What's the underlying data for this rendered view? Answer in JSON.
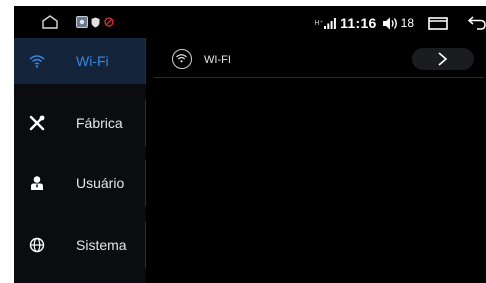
{
  "status": {
    "time": "11:16",
    "volume": "18",
    "signal_tag": "H⁺"
  },
  "sidebar": {
    "items": [
      {
        "label": "Wi-Fi",
        "icon": "wifi-icon",
        "active": true
      },
      {
        "label": "Fábrica",
        "icon": "tools-icon",
        "active": false
      },
      {
        "label": "Usuário",
        "icon": "user-icon",
        "active": false
      },
      {
        "label": "Sistema",
        "icon": "globe-icon",
        "active": false
      }
    ]
  },
  "content": {
    "wifi_row": {
      "label": "WI-FI",
      "action_icon": "chevron-right-icon"
    }
  },
  "colors": {
    "accent": "#3a86e0",
    "active_bg": "#14243a",
    "background": "#000000"
  }
}
